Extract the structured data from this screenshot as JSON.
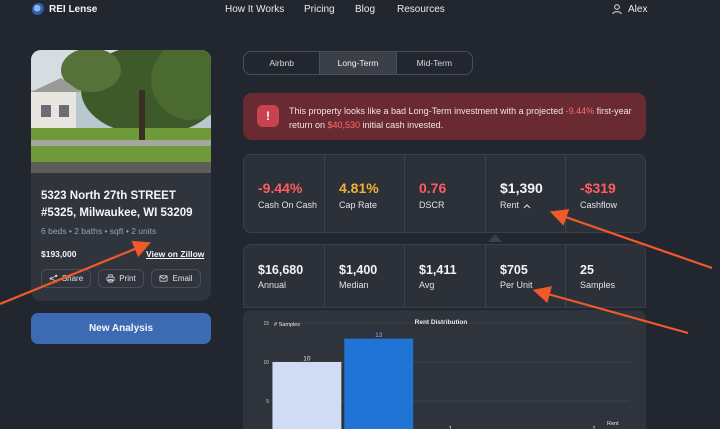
{
  "nav": {
    "brand": "REI Lense",
    "links": [
      "How It Works",
      "Pricing",
      "Blog",
      "Resources"
    ],
    "user": "Alex"
  },
  "property": {
    "address": "5323 North 27th STREET #5325, Milwaukee, WI 53209",
    "specs": "6 beds • 2 baths • sqft • 2 units",
    "price": "$193,000",
    "zillow_link": "View on Zillow",
    "actions": [
      "Share",
      "Print",
      "Email"
    ]
  },
  "new_analysis": "New Analysis",
  "tabs": [
    "Airbnb",
    "Long-Term",
    "Mid-Term"
  ],
  "active_tab": "Long-Term",
  "alert": {
    "text_1": "This property looks like a bad Long-Term investment with a projected ",
    "return_pct": "-9.44%",
    "text_2": " first-year return on ",
    "cash": "$40,530",
    "text_3": " initial cash invested."
  },
  "metrics": [
    {
      "value": "-9.44%",
      "label": "Cash On Cash",
      "tone": "neg"
    },
    {
      "value": "4.81%",
      "label": "Cap Rate",
      "tone": "warn"
    },
    {
      "value": "0.76",
      "label": "DSCR",
      "tone": "neg"
    },
    {
      "value": "$1,390",
      "label": "Rent",
      "tone": "normal"
    },
    {
      "value": "-$319",
      "label": "Cashflow",
      "tone": "neg"
    }
  ],
  "rent_stats": [
    {
      "value": "$16,680",
      "label": "Annual"
    },
    {
      "value": "$1,400",
      "label": "Median"
    },
    {
      "value": "$1,411",
      "label": "Avg"
    },
    {
      "value": "$705",
      "label": "Per Unit"
    },
    {
      "value": "25",
      "label": "Samples"
    }
  ],
  "colors": {
    "negative": "#ff5c61",
    "warning": "#f5b133",
    "accent": "#3d6bb3",
    "alert_bg": "#6a2a31"
  },
  "chart_data": {
    "type": "bar",
    "title": "Rent Distribution",
    "ylabel": "# Samples",
    "xlabel": "Rent",
    "ylim": [
      0,
      15
    ],
    "yticks": [
      5,
      10,
      15
    ],
    "values": [
      10,
      13,
      1,
      0,
      1
    ],
    "highlight_index": 1
  }
}
